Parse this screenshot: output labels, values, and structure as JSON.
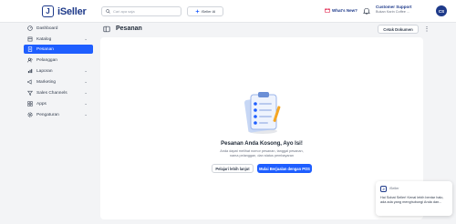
{
  "app": {
    "logo_glyph": "J",
    "name": "iSeller"
  },
  "header": {
    "search_placeholder": "Cari apa saja",
    "ai_button_label": "iSeller AI",
    "whats_new_label": "What's New?",
    "user_name": "Customer Support",
    "user_company": "Bukan Karin Coffee ...",
    "avatar_initials": "CS"
  },
  "sidebar": {
    "items": [
      {
        "label": "Dashboard",
        "icon": "dashboard-icon",
        "has_chevron": false,
        "active": false
      },
      {
        "label": "Katalog",
        "icon": "catalog-icon",
        "has_chevron": true,
        "active": false
      },
      {
        "label": "Pesanan",
        "icon": "orders-icon",
        "has_chevron": false,
        "active": true
      },
      {
        "label": "Pelanggan",
        "icon": "customers-icon",
        "has_chevron": false,
        "active": false
      },
      {
        "label": "Laporan",
        "icon": "reports-icon",
        "has_chevron": true,
        "active": false
      },
      {
        "label": "Marketing",
        "icon": "marketing-icon",
        "has_chevron": true,
        "active": false
      },
      {
        "label": "Sales Channels",
        "icon": "sales-channels-icon",
        "has_chevron": true,
        "active": false
      },
      {
        "label": "Apps",
        "icon": "apps-icon",
        "has_chevron": true,
        "active": false
      },
      {
        "label": "Pengaturan",
        "icon": "settings-icon",
        "has_chevron": true,
        "active": false
      }
    ]
  },
  "page": {
    "title": "Pesanan",
    "print_button_label": "Cetak Dokumen",
    "empty_title": "Pesanan Anda Kosong, Ayo Isi!",
    "empty_description": "Anda dapat melihat nomor pesanan, tanggal pesanan, nama pelanggan, dan status pembayaran",
    "learn_more_label": "Pelajari lebih lanjut",
    "start_pos_label": "Mulai Berjualan dengan POS"
  },
  "chat": {
    "sender": "iSeller",
    "message": "Hai Sobat Seller! Kenal lebih bentar halo, ada ada yang menghubungi Anda dan..."
  },
  "colors": {
    "brand": "#1e3a8a",
    "primary": "#1e5eff",
    "background": "#f3f4f6"
  }
}
